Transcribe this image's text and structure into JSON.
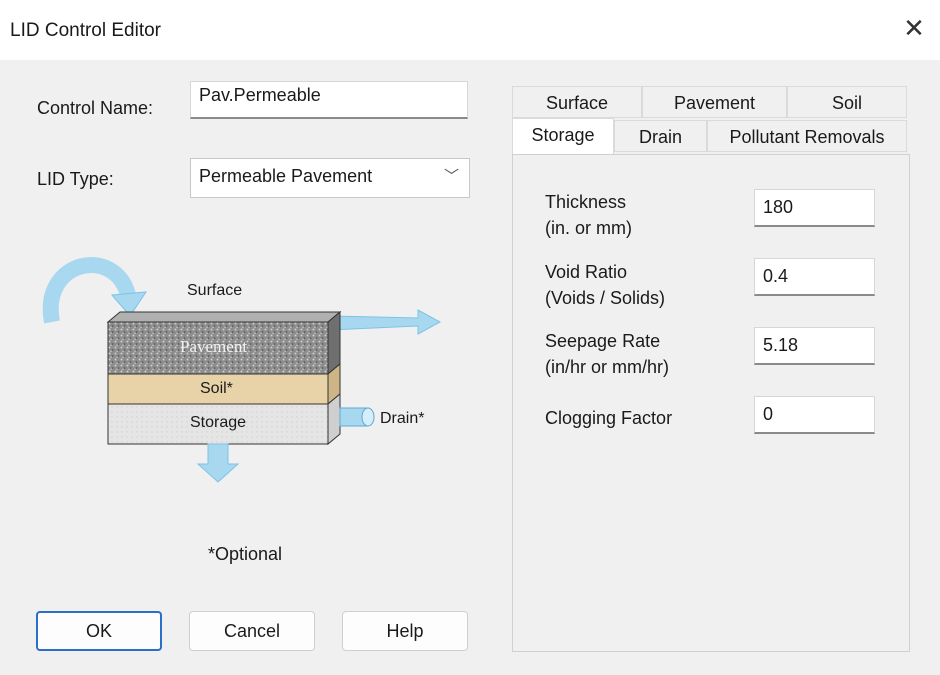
{
  "window": {
    "title": "LID Control Editor",
    "close_glyph": "✕"
  },
  "form": {
    "control_name_label": "Control Name:",
    "control_name_value": "Pav.Permeable",
    "lid_type_label": "LID Type:",
    "lid_type_value": "Permeable Pavement"
  },
  "diagram": {
    "surface_label": "Surface",
    "pavement_label": "Pavement",
    "soil_label": "Soil*",
    "storage_label": "Storage",
    "drain_label": "Drain*",
    "optional_note": "*Optional",
    "colors": {
      "pavement": "#8d8d8d",
      "soil": "#e8d3a8",
      "storage": "#e5e5e5",
      "arrow": "#a8d8f0"
    }
  },
  "buttons": {
    "ok": "OK",
    "cancel": "Cancel",
    "help": "Help"
  },
  "tabs": {
    "row1": [
      "Surface",
      "Pavement",
      "Soil"
    ],
    "row2": [
      "Storage",
      "Drain",
      "Pollutant Removals"
    ],
    "active": "Storage"
  },
  "storage": {
    "thickness": {
      "label1": "Thickness",
      "label2": "(in. or mm)",
      "value": "180"
    },
    "void_ratio": {
      "label1": "Void Ratio",
      "label2": "(Voids / Solids)",
      "value": "0.4"
    },
    "seepage_rate": {
      "label1": "Seepage Rate",
      "label2": "(in/hr or mm/hr)",
      "value": "5.18"
    },
    "clogging_factor": {
      "label1": "Clogging Factor",
      "value": "0"
    }
  }
}
